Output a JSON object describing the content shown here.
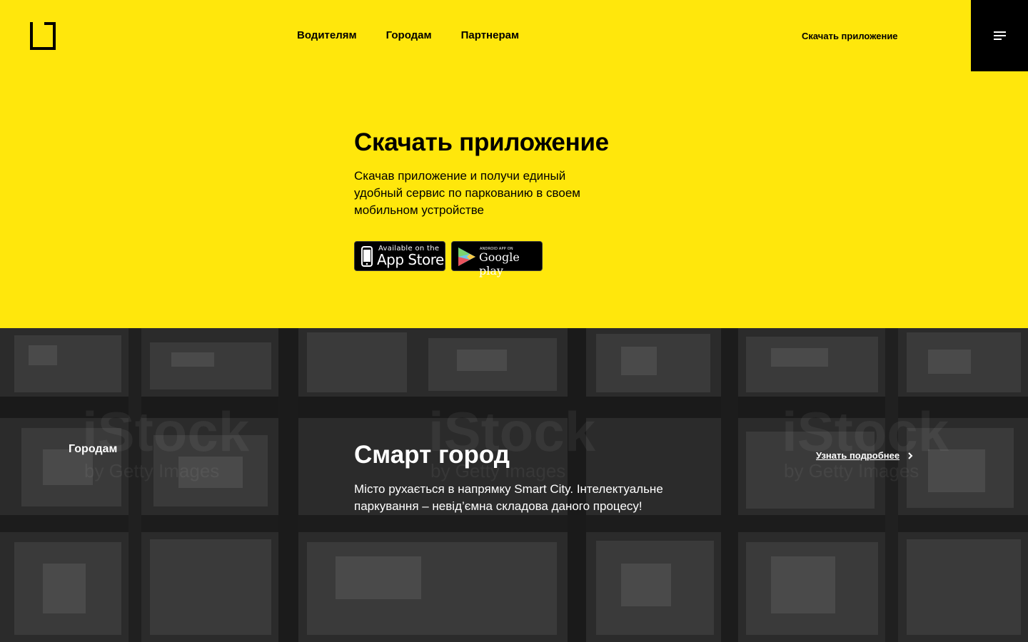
{
  "header": {
    "nav": [
      "Водителям",
      "Городам",
      "Партнерам"
    ],
    "download_link": "Скачать приложение"
  },
  "hero": {
    "title": "Скачать приложение",
    "text": "Скачав приложение и получи единый удобный сервис по паркованию в своем мобильном устройстве",
    "app_store": {
      "small": "Available on the",
      "big": "App Store"
    },
    "google_play": {
      "small": "ANDROID APP ON",
      "big": "Google play"
    }
  },
  "city_section": {
    "label": "Городам",
    "title": "Смарт город",
    "text": "Місто рухається в напрямку Smart City. Інтелектуальне паркування – невід’ємна складова даного процесу!",
    "more_link": "Узнать подробнее",
    "watermark": "iStock",
    "watermark_sub": "by Getty Images"
  },
  "colors": {
    "brand_yellow": "#FFE70C",
    "black": "#000000",
    "white": "#FFFFFF"
  },
  "icons": {
    "logo": "bracket-logo-icon",
    "menu": "hamburger-menu-icon",
    "apple_phone": "phone-icon",
    "google_play": "play-triangle-icon",
    "chevron": "chevron-right-icon"
  }
}
